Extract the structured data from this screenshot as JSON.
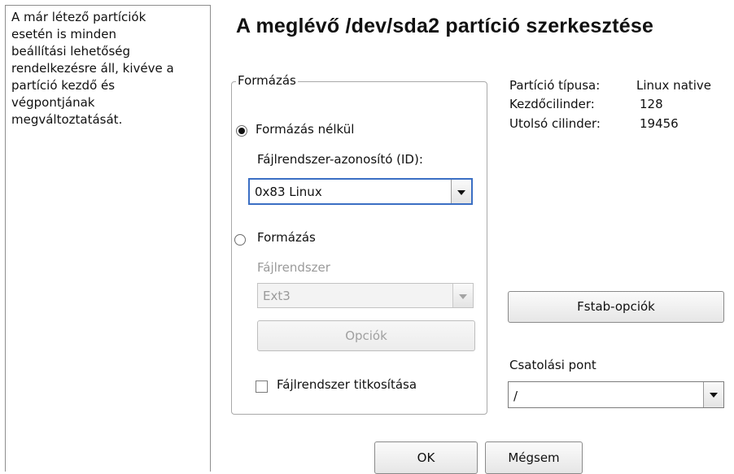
{
  "help": {
    "lines": [
      "A már létező partíciók",
      "esetén is minden",
      "beállítási lehetőség",
      "rendelkezésre áll, kivéve a",
      "partíció kezdő és",
      "végpontjának",
      "megváltoztatását."
    ]
  },
  "title": "A meglévő /dev/sda2 partíció szerkesztése",
  "format_group": {
    "legend": "Formázás",
    "no_format_label": "Formázás nélkül",
    "fs_id_label": "Fájlrendszer-azonosító (ID):",
    "fs_id_value": "0x83 Linux",
    "format_label": "Formázás",
    "filesystem_label": "Fájlrendszer",
    "filesystem_value": "Ext3",
    "options_button": "Opciók",
    "encrypt_label": "Fájlrendszer titkosítása"
  },
  "info": {
    "rows": [
      {
        "label": "Partíció típusa:",
        "value": "Linux native"
      },
      {
        "label": "Kezdőcilinder:",
        "value": "128"
      },
      {
        "label": "Utolsó cilinder:",
        "value": "19456"
      }
    ]
  },
  "fstab_button": "Fstab-opciók",
  "mount": {
    "label": "Csatolási pont",
    "value": "/"
  },
  "buttons": {
    "ok": "OK",
    "cancel": "Mégsem"
  }
}
